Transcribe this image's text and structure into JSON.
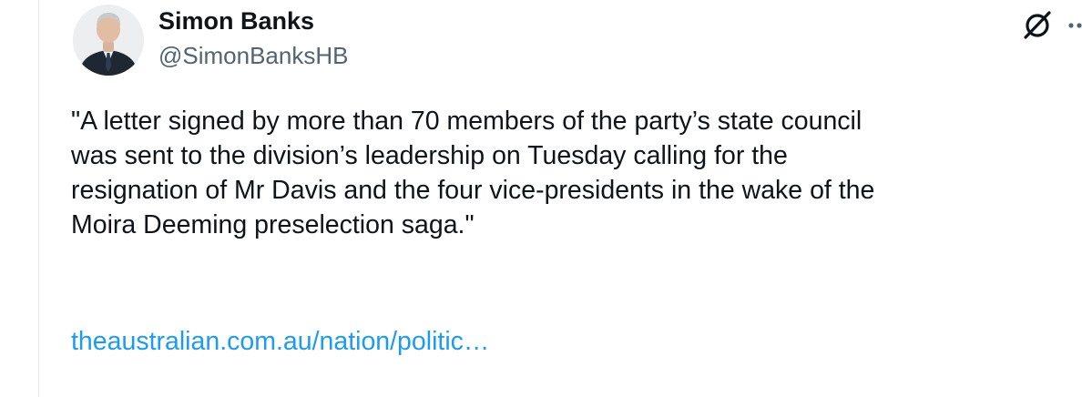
{
  "tweet": {
    "author": {
      "name": "Simon Banks",
      "handle": "@SimonBanksHB",
      "avatar_icon": "profile-photo"
    },
    "text": "\"A letter signed by more than 70 members of the party’s state council\nwas sent to the division’s leadership on Tuesday calling for the\nresignation of Mr Davis and the four vice-presidents in the wake of the\nMoira Deeming preselection saga.\"",
    "link": "theaustralian.com.au/nation/politic…",
    "actions": {
      "grok_icon": "grok-slash-circle-icon",
      "more_icon": "more-dots-icon"
    }
  },
  "colors": {
    "text": "#0f1419",
    "secondary": "#536471",
    "link": "#1d9bf0",
    "divider": "#e4e8eb"
  }
}
